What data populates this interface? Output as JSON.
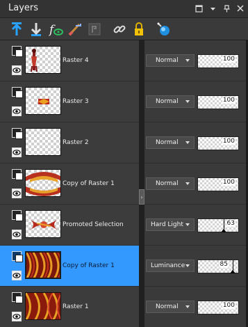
{
  "panel": {
    "title": "Layers"
  },
  "titlebar_buttons": [
    {
      "name": "maximize-icon",
      "glyph": "▢"
    },
    {
      "name": "menu-chevron-icon",
      "glyph": "▾"
    },
    {
      "name": "pin-icon",
      "glyph": "⊥"
    },
    {
      "name": "close-icon",
      "glyph": "✕"
    }
  ],
  "toolbar_icons": [
    {
      "name": "new-raster-layer-icon"
    },
    {
      "name": "new-vector-layer-icon"
    },
    {
      "name": "new-art-media-layer-icon"
    },
    {
      "name": "new-mask-layer-icon"
    },
    {
      "name": "new-adjustment-layer-icon"
    },
    {
      "name": "link-icon"
    },
    {
      "name": "lock-icon"
    },
    {
      "name": "layer-effects-icon"
    }
  ],
  "layers": [
    {
      "name": "Raster 4",
      "blend": "Normal",
      "opacity": "100",
      "selected": false
    },
    {
      "name": "Raster 3",
      "blend": "Normal",
      "opacity": "100",
      "selected": false
    },
    {
      "name": "Raster 2",
      "blend": "Normal",
      "opacity": "100",
      "selected": false
    },
    {
      "name": "Copy of Raster 1",
      "blend": "Normal",
      "opacity": "100",
      "selected": false
    },
    {
      "name": "Promoted Selection",
      "blend": "Hard Light",
      "opacity": "63",
      "selected": false
    },
    {
      "name": "Copy of Raster 1",
      "blend": "Luminance",
      "opacity": "85",
      "selected": true
    },
    {
      "name": "Raster 1",
      "blend": "Normal",
      "opacity": "100",
      "selected": false
    }
  ],
  "colors": {
    "selection": "#3399ff",
    "panel_bg": "#2b2b2b",
    "row_bg": "#3c3c3c",
    "toolbar_accent": "#29a3ff"
  }
}
